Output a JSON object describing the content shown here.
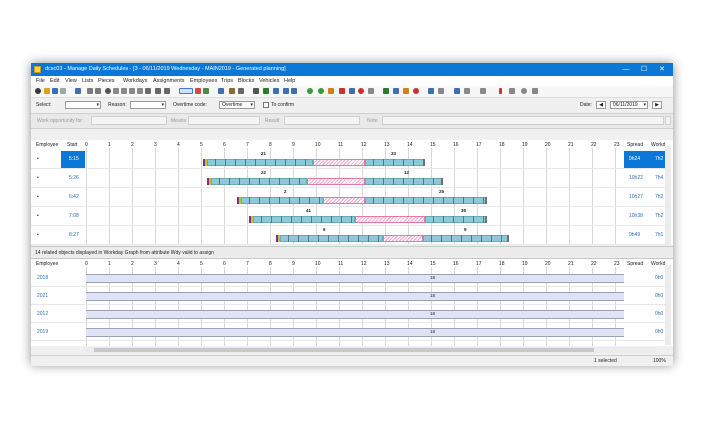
{
  "window": {
    "title": "dcsc03 - Manage Daily Schedules - [3 - 06/11/2019 Wednesday - MAIN2019 - Generated planning]",
    "controls": {
      "minimize": "—",
      "maximize": "☐",
      "close": "✕"
    }
  },
  "menu": [
    "File",
    "Edit",
    "View",
    "Lists",
    "Pieces",
    "Workdays",
    "Assignments",
    "Employees",
    "Trips",
    "Blocks",
    "Vehicles",
    "Help"
  ],
  "selection_bar": {
    "select_label": "Select:",
    "reason_label": "Reason:",
    "overtime_code_label": "Overtime code:",
    "overtime_value": "Overtime",
    "to_confirm_label": "To confirm",
    "date_label": "Date:",
    "date_value": "06/11/2019"
  },
  "filter_bar": {
    "work_opportunity_label": "Work opportunity for:",
    "means_label": "Means",
    "result_label": "Result",
    "note_label": "Note"
  },
  "upper_grid": {
    "headers": {
      "employee": "Employee",
      "start": "Start",
      "spread": "Spread",
      "workday": "Workd"
    },
    "hours": [
      "0",
      "1",
      "2",
      "3",
      "4",
      "5",
      "6",
      "7",
      "8",
      "9",
      "10",
      "11",
      "12",
      "13",
      "14",
      "15",
      "16",
      "17",
      "18",
      "19",
      "20",
      "21",
      "22",
      "23"
    ],
    "rows": [
      {
        "employee": "•",
        "start": "5:15",
        "left_num": "21",
        "right_num": "33",
        "spread": "9h24",
        "workday": "7h2",
        "selected": true
      },
      {
        "employee": "•",
        "start": "5:26",
        "left_num": "22",
        "right_num": "12",
        "spread": "10h22",
        "workday": "7h4"
      },
      {
        "employee": "•",
        "start": "6:42",
        "left_num": "2",
        "right_num": "25",
        "spread": "10h27",
        "workday": "7h2"
      },
      {
        "employee": "•",
        "start": "7:08",
        "left_num": "41",
        "right_num": "35",
        "spread": "10h38",
        "workday": "7h2"
      },
      {
        "employee": "•",
        "start": "8:27",
        "left_num": "6",
        "right_num": "9",
        "spread": "9h49",
        "workday": "7h1"
      }
    ]
  },
  "lower_panel": {
    "caption": "14 related objects displayed in Workday Graph from attribute Wdy valid to assign",
    "headers": {
      "employee": "Employee",
      "spread": "Spread",
      "workday": "Workd"
    },
    "rows": [
      {
        "employee": "2018",
        "label": "18",
        "workday": "0h0"
      },
      {
        "employee": "2021",
        "label": "18",
        "workday": "0h0"
      },
      {
        "employee": "2012",
        "label": "18",
        "workday": "0h0"
      },
      {
        "employee": "2019",
        "label": "18",
        "workday": "0h0"
      }
    ]
  },
  "status_bar": {
    "selected": "1 selected",
    "zoom": "100%"
  }
}
